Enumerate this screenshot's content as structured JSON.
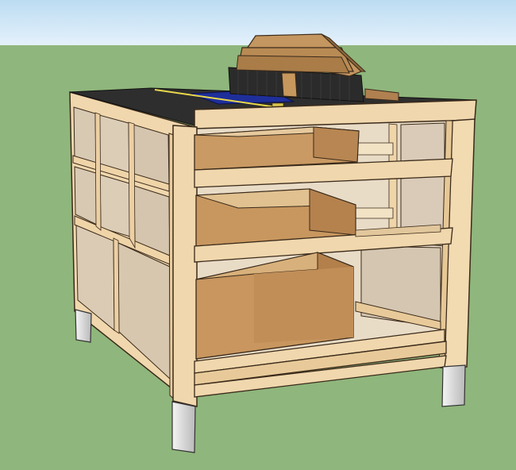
{
  "scene": {
    "subject": "workbench-cabinet-with-table-saw",
    "drawers_visible": 3,
    "colors": {
      "sky": "#cde3f4",
      "ground": "#8fb67c",
      "frame_wood": "#f0d7ad",
      "frame_edge": "#3a2a1a",
      "panel_plywood": "#d9cbb8",
      "drawer_box": "#c99a63",
      "drawer_inner": "#e8d0a8",
      "saw_body": "#2b2b2b",
      "saw_table_blue": "#1f2f9a",
      "fence_wood": "#b98b54",
      "leg_metal": "#d8d8d8"
    }
  }
}
